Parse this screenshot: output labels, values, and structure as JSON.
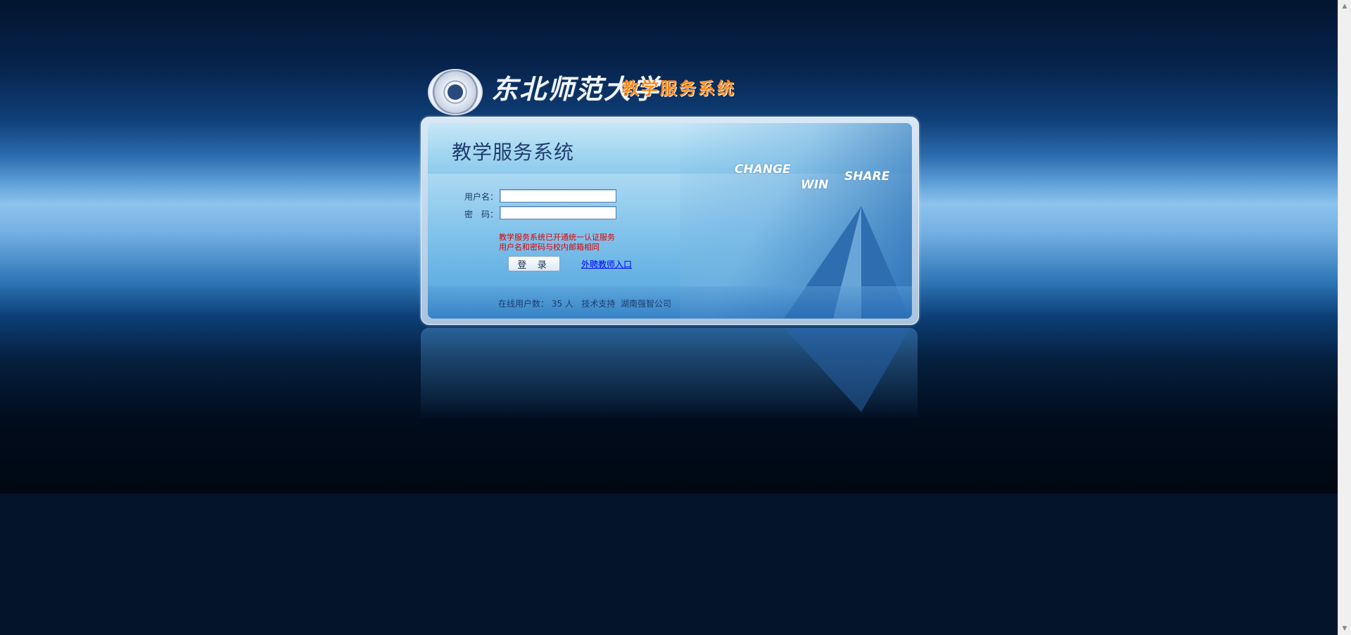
{
  "header": {
    "school_name": "东北师范大学",
    "system_name": "教学服务系统"
  },
  "panel": {
    "title": "教学服务系统",
    "slogans": {
      "change": "CHANGE",
      "win": "WIN",
      "share": "SHARE"
    }
  },
  "form": {
    "username_label": "用户名：",
    "password_label": "密　码：",
    "username_value": "",
    "password_value": "",
    "notice_line1": "教学服务系统已开通统一认证服务",
    "notice_line2": "用户名和密码与校内邮箱相同",
    "login_button": "登 录",
    "teacher_link": "外聘教师入口"
  },
  "footer": {
    "status": "在线用户数： 35 人   技术支持  湖南强智公司"
  },
  "icons": {
    "seal": "university-seal-icon",
    "scroll_up": "scroll-up-arrow-icon",
    "scroll_down": "scroll-down-arrow-icon"
  }
}
